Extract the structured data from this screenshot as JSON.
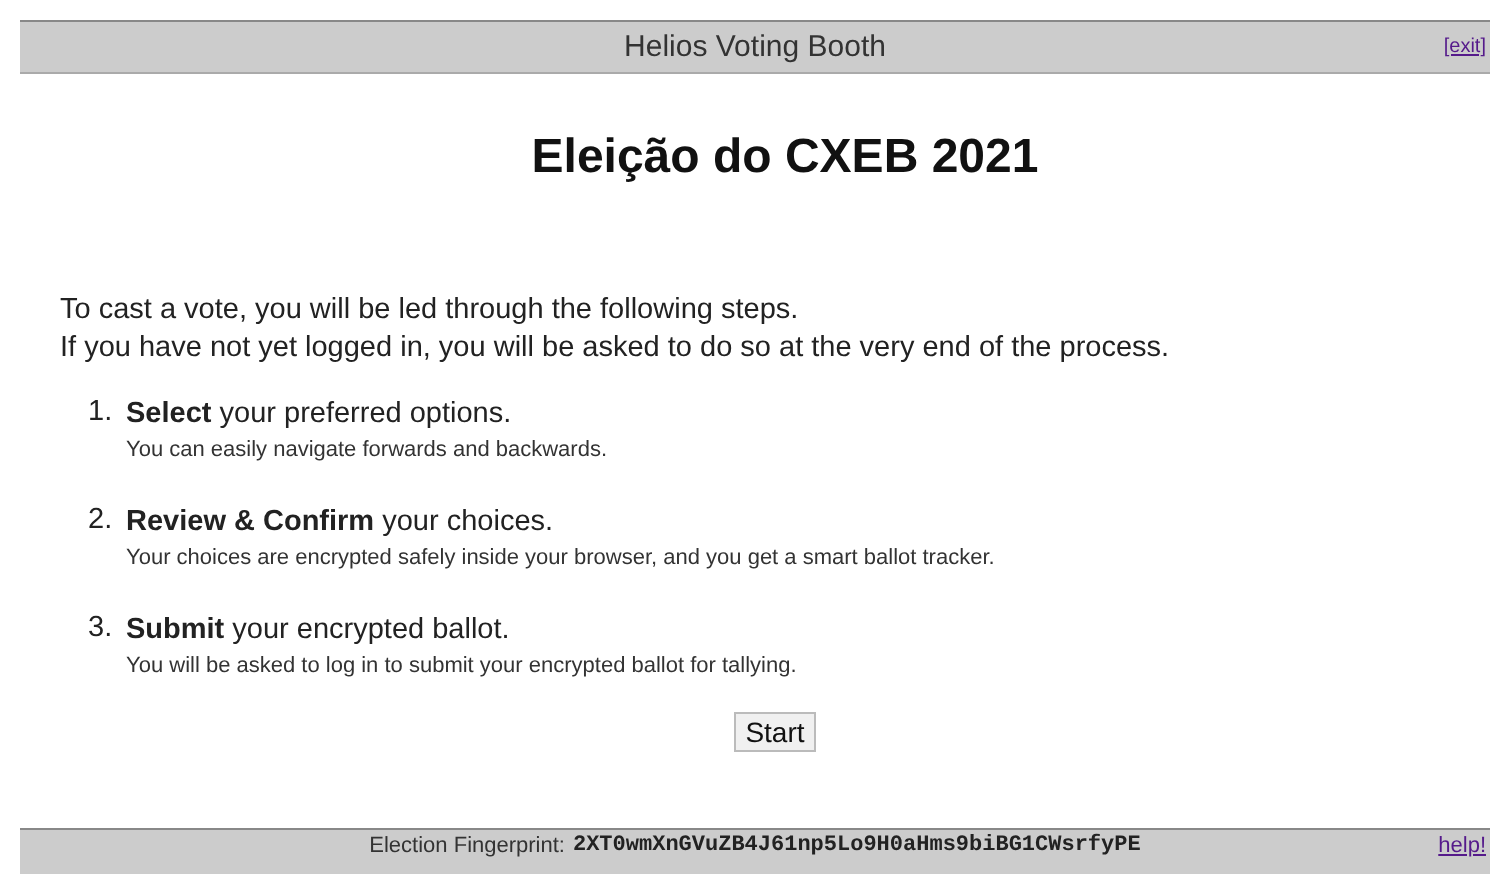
{
  "header": {
    "title": "Helios Voting Booth",
    "exit_link": "[exit]"
  },
  "election_title": "Eleição do CXEB 2021",
  "intro": [
    "To cast a vote, you will be led through the following steps.",
    "If you have not yet logged in, you will be asked to do so at the very end of the process."
  ],
  "steps": [
    {
      "number": "1.",
      "text": "**Select** your preferred options.",
      "detail": "You can easily navigate forwards and backwards."
    },
    {
      "number": "2.",
      "text": "**Review & Confirm** your choices.",
      "detail": "Your choices are encrypted safely inside your browser, and you get a smart ballot tracker."
    },
    {
      "number": "3.",
      "text": "**Submit** your encrypted ballot.",
      "detail": "You will be asked to log in to submit your encrypted ballot for tallying."
    }
  ],
  "start_button": "Start",
  "footer": {
    "label": "Election Fingerprint:",
    "fingerprint": "2XT0wmXnGVuZB4J61np5Lo9H0aHms9biBG1CWsrfyPE",
    "help_link": "help!"
  }
}
